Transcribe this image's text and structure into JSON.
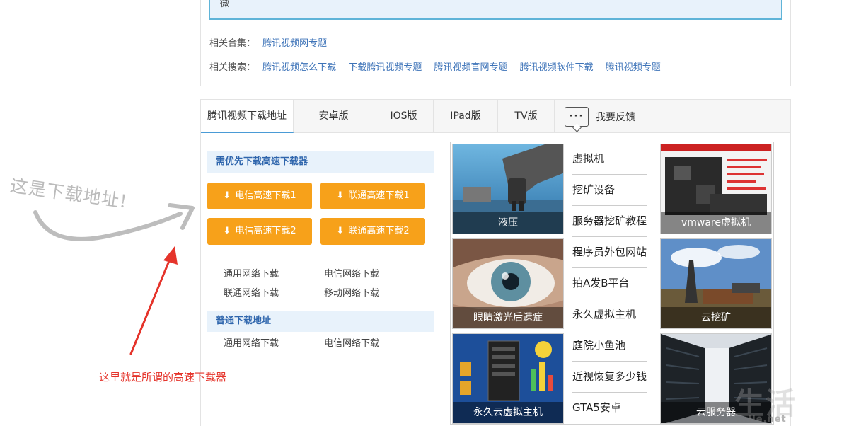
{
  "top": {
    "partial_text": "微",
    "related_collections_label": "相关合集：",
    "related_collections": [
      "腾讯视频网专题"
    ],
    "related_searches_label": "相关搜索：",
    "related_searches": [
      "腾讯视频怎么下载",
      "下载腾讯视频专题",
      "腾讯视频官网专题",
      "腾讯视频软件下载",
      "腾讯视频专题"
    ]
  },
  "tabs": {
    "items": [
      "腾讯视频下载地址",
      "安卓版",
      "IOS版",
      "IPad版",
      "TV版"
    ],
    "active": "腾讯视频下载地址",
    "feedback_icon_text": "···",
    "feedback_label": "我要反馈"
  },
  "download": {
    "fast_header": "需优先下载高速下载器",
    "buttons": [
      "电信高速下载1",
      "联通高速下载1",
      "电信高速下载2",
      "联通高速下载2"
    ],
    "fast_links": [
      "通用网络下载",
      "电信网络下载",
      "联通网络下载",
      "移动网络下载"
    ],
    "normal_header": "普通下载地址",
    "normal_links": [
      "通用网络下载",
      "电信网络下载"
    ]
  },
  "ads": {
    "left_tiles": [
      "液压",
      "眼睛激光后遗症",
      "永久云虚拟主机"
    ],
    "right_tiles": [
      "vmware虚拟机",
      "云挖矿",
      "云服务器"
    ],
    "text_links": [
      "虚拟机",
      "挖矿设备",
      "服务器挖矿教程",
      "程序员外包网站",
      "拍A发B平台",
      "永久虚拟主机",
      "庭院小鱼池",
      "近视恢复多少钱",
      "GTA5安卓"
    ]
  },
  "annotations": {
    "handwritten": "这是下载地址!",
    "red_note": "这里就是所谓的高速下载器",
    "watermark": "生活",
    "watermark_url": "...lle.net"
  },
  "colors": {
    "accent_blue": "#3d73b8",
    "button_orange": "#f7a11a",
    "annotation_red": "#e5342b",
    "header_bg": "#e8f2fb"
  }
}
